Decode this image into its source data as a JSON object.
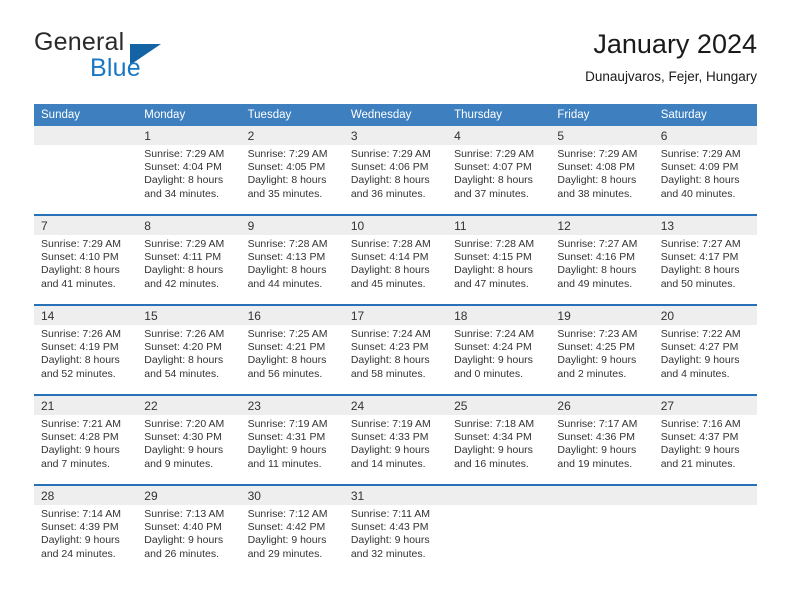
{
  "brand": {
    "word1": "General",
    "word2": "Blue",
    "triangle_color": "#1464a5",
    "blue_color": "#1878c6"
  },
  "header": {
    "title": "January 2024",
    "subtitle": "Dunaujvaros, Fejer, Hungary"
  },
  "theme": {
    "header_row_bg": "#3d7fbf",
    "week_separator": "#2870b8",
    "daynum_band_bg": "#eeeeee",
    "text": "#333333"
  },
  "calendar": {
    "weekday_headers": [
      "Sunday",
      "Monday",
      "Tuesday",
      "Wednesday",
      "Thursday",
      "Friday",
      "Saturday"
    ],
    "weeks": [
      [
        {
          "day": "",
          "empty": true,
          "sunrise": "",
          "sunset": "",
          "daylight1": "",
          "daylight2": ""
        },
        {
          "day": "1",
          "empty": false,
          "sunrise": "Sunrise: 7:29 AM",
          "sunset": "Sunset: 4:04 PM",
          "daylight1": "Daylight: 8 hours",
          "daylight2": "and 34 minutes."
        },
        {
          "day": "2",
          "empty": false,
          "sunrise": "Sunrise: 7:29 AM",
          "sunset": "Sunset: 4:05 PM",
          "daylight1": "Daylight: 8 hours",
          "daylight2": "and 35 minutes."
        },
        {
          "day": "3",
          "empty": false,
          "sunrise": "Sunrise: 7:29 AM",
          "sunset": "Sunset: 4:06 PM",
          "daylight1": "Daylight: 8 hours",
          "daylight2": "and 36 minutes."
        },
        {
          "day": "4",
          "empty": false,
          "sunrise": "Sunrise: 7:29 AM",
          "sunset": "Sunset: 4:07 PM",
          "daylight1": "Daylight: 8 hours",
          "daylight2": "and 37 minutes."
        },
        {
          "day": "5",
          "empty": false,
          "sunrise": "Sunrise: 7:29 AM",
          "sunset": "Sunset: 4:08 PM",
          "daylight1": "Daylight: 8 hours",
          "daylight2": "and 38 minutes."
        },
        {
          "day": "6",
          "empty": false,
          "sunrise": "Sunrise: 7:29 AM",
          "sunset": "Sunset: 4:09 PM",
          "daylight1": "Daylight: 8 hours",
          "daylight2": "and 40 minutes."
        }
      ],
      [
        {
          "day": "7",
          "empty": false,
          "sunrise": "Sunrise: 7:29 AM",
          "sunset": "Sunset: 4:10 PM",
          "daylight1": "Daylight: 8 hours",
          "daylight2": "and 41 minutes."
        },
        {
          "day": "8",
          "empty": false,
          "sunrise": "Sunrise: 7:29 AM",
          "sunset": "Sunset: 4:11 PM",
          "daylight1": "Daylight: 8 hours",
          "daylight2": "and 42 minutes."
        },
        {
          "day": "9",
          "empty": false,
          "sunrise": "Sunrise: 7:28 AM",
          "sunset": "Sunset: 4:13 PM",
          "daylight1": "Daylight: 8 hours",
          "daylight2": "and 44 minutes."
        },
        {
          "day": "10",
          "empty": false,
          "sunrise": "Sunrise: 7:28 AM",
          "sunset": "Sunset: 4:14 PM",
          "daylight1": "Daylight: 8 hours",
          "daylight2": "and 45 minutes."
        },
        {
          "day": "11",
          "empty": false,
          "sunrise": "Sunrise: 7:28 AM",
          "sunset": "Sunset: 4:15 PM",
          "daylight1": "Daylight: 8 hours",
          "daylight2": "and 47 minutes."
        },
        {
          "day": "12",
          "empty": false,
          "sunrise": "Sunrise: 7:27 AM",
          "sunset": "Sunset: 4:16 PM",
          "daylight1": "Daylight: 8 hours",
          "daylight2": "and 49 minutes."
        },
        {
          "day": "13",
          "empty": false,
          "sunrise": "Sunrise: 7:27 AM",
          "sunset": "Sunset: 4:17 PM",
          "daylight1": "Daylight: 8 hours",
          "daylight2": "and 50 minutes."
        }
      ],
      [
        {
          "day": "14",
          "empty": false,
          "sunrise": "Sunrise: 7:26 AM",
          "sunset": "Sunset: 4:19 PM",
          "daylight1": "Daylight: 8 hours",
          "daylight2": "and 52 minutes."
        },
        {
          "day": "15",
          "empty": false,
          "sunrise": "Sunrise: 7:26 AM",
          "sunset": "Sunset: 4:20 PM",
          "daylight1": "Daylight: 8 hours",
          "daylight2": "and 54 minutes."
        },
        {
          "day": "16",
          "empty": false,
          "sunrise": "Sunrise: 7:25 AM",
          "sunset": "Sunset: 4:21 PM",
          "daylight1": "Daylight: 8 hours",
          "daylight2": "and 56 minutes."
        },
        {
          "day": "17",
          "empty": false,
          "sunrise": "Sunrise: 7:24 AM",
          "sunset": "Sunset: 4:23 PM",
          "daylight1": "Daylight: 8 hours",
          "daylight2": "and 58 minutes."
        },
        {
          "day": "18",
          "empty": false,
          "sunrise": "Sunrise: 7:24 AM",
          "sunset": "Sunset: 4:24 PM",
          "daylight1": "Daylight: 9 hours",
          "daylight2": "and 0 minutes."
        },
        {
          "day": "19",
          "empty": false,
          "sunrise": "Sunrise: 7:23 AM",
          "sunset": "Sunset: 4:25 PM",
          "daylight1": "Daylight: 9 hours",
          "daylight2": "and 2 minutes."
        },
        {
          "day": "20",
          "empty": false,
          "sunrise": "Sunrise: 7:22 AM",
          "sunset": "Sunset: 4:27 PM",
          "daylight1": "Daylight: 9 hours",
          "daylight2": "and 4 minutes."
        }
      ],
      [
        {
          "day": "21",
          "empty": false,
          "sunrise": "Sunrise: 7:21 AM",
          "sunset": "Sunset: 4:28 PM",
          "daylight1": "Daylight: 9 hours",
          "daylight2": "and 7 minutes."
        },
        {
          "day": "22",
          "empty": false,
          "sunrise": "Sunrise: 7:20 AM",
          "sunset": "Sunset: 4:30 PM",
          "daylight1": "Daylight: 9 hours",
          "daylight2": "and 9 minutes."
        },
        {
          "day": "23",
          "empty": false,
          "sunrise": "Sunrise: 7:19 AM",
          "sunset": "Sunset: 4:31 PM",
          "daylight1": "Daylight: 9 hours",
          "daylight2": "and 11 minutes."
        },
        {
          "day": "24",
          "empty": false,
          "sunrise": "Sunrise: 7:19 AM",
          "sunset": "Sunset: 4:33 PM",
          "daylight1": "Daylight: 9 hours",
          "daylight2": "and 14 minutes."
        },
        {
          "day": "25",
          "empty": false,
          "sunrise": "Sunrise: 7:18 AM",
          "sunset": "Sunset: 4:34 PM",
          "daylight1": "Daylight: 9 hours",
          "daylight2": "and 16 minutes."
        },
        {
          "day": "26",
          "empty": false,
          "sunrise": "Sunrise: 7:17 AM",
          "sunset": "Sunset: 4:36 PM",
          "daylight1": "Daylight: 9 hours",
          "daylight2": "and 19 minutes."
        },
        {
          "day": "27",
          "empty": false,
          "sunrise": "Sunrise: 7:16 AM",
          "sunset": "Sunset: 4:37 PM",
          "daylight1": "Daylight: 9 hours",
          "daylight2": "and 21 minutes."
        }
      ],
      [
        {
          "day": "28",
          "empty": false,
          "sunrise": "Sunrise: 7:14 AM",
          "sunset": "Sunset: 4:39 PM",
          "daylight1": "Daylight: 9 hours",
          "daylight2": "and 24 minutes."
        },
        {
          "day": "29",
          "empty": false,
          "sunrise": "Sunrise: 7:13 AM",
          "sunset": "Sunset: 4:40 PM",
          "daylight1": "Daylight: 9 hours",
          "daylight2": "and 26 minutes."
        },
        {
          "day": "30",
          "empty": false,
          "sunrise": "Sunrise: 7:12 AM",
          "sunset": "Sunset: 4:42 PM",
          "daylight1": "Daylight: 9 hours",
          "daylight2": "and 29 minutes."
        },
        {
          "day": "31",
          "empty": false,
          "sunrise": "Sunrise: 7:11 AM",
          "sunset": "Sunset: 4:43 PM",
          "daylight1": "Daylight: 9 hours",
          "daylight2": "and 32 minutes."
        },
        {
          "day": "",
          "empty": true,
          "sunrise": "",
          "sunset": "",
          "daylight1": "",
          "daylight2": ""
        },
        {
          "day": "",
          "empty": true,
          "sunrise": "",
          "sunset": "",
          "daylight1": "",
          "daylight2": ""
        },
        {
          "day": "",
          "empty": true,
          "sunrise": "",
          "sunset": "",
          "daylight1": "",
          "daylight2": ""
        }
      ]
    ]
  }
}
